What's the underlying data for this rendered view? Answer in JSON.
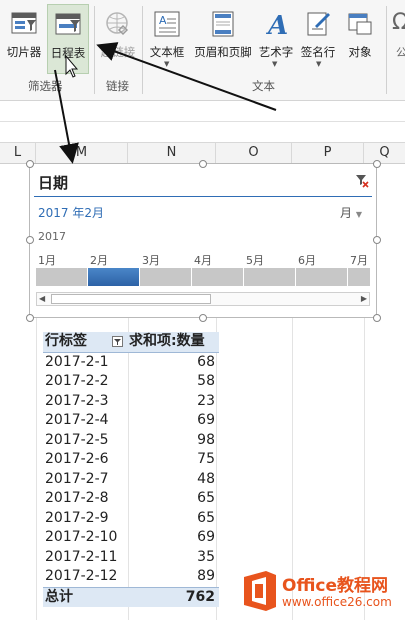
{
  "ribbon": {
    "buttons": {
      "slicer": "切片器",
      "timeline": "日程表",
      "link": "超链接",
      "textbox": "文本框",
      "header_footer": "页眉和页脚",
      "wordart": "艺术字",
      "signature": "签名行",
      "object": "对象"
    },
    "groups": {
      "filter": "筛选器",
      "links": "链接",
      "text": "文本"
    }
  },
  "columns": [
    "L",
    "M",
    "N",
    "O",
    "P",
    "Q"
  ],
  "timeline": {
    "title": "日期",
    "selection": "2017 年2月",
    "level": "月",
    "year": "2017",
    "months": [
      "1月",
      "2月",
      "3月",
      "4月",
      "5月",
      "6月",
      "7月"
    ],
    "selected_month": "2月"
  },
  "pivot": {
    "header_label": "行标签",
    "header_value": "求和项:数量",
    "rows": [
      {
        "k": "2017-2-1",
        "v": "68"
      },
      {
        "k": "2017-2-2",
        "v": "58"
      },
      {
        "k": "2017-2-3",
        "v": "23"
      },
      {
        "k": "2017-2-4",
        "v": "69"
      },
      {
        "k": "2017-2-5",
        "v": "98"
      },
      {
        "k": "2017-2-6",
        "v": "75"
      },
      {
        "k": "2017-2-7",
        "v": "48"
      },
      {
        "k": "2017-2-8",
        "v": "65"
      },
      {
        "k": "2017-2-9",
        "v": "65"
      },
      {
        "k": "2017-2-10",
        "v": "69"
      },
      {
        "k": "2017-2-11",
        "v": "35"
      },
      {
        "k": "2017-2-12",
        "v": "89"
      }
    ],
    "total_label": "总计",
    "total_value": "762"
  },
  "watermark": {
    "brand": "Office教程网",
    "url": "www.office26.com"
  },
  "colors": {
    "accent": "#2f6db5",
    "orange": "#e8541d",
    "ribbon_bg": "#f6f6f6"
  }
}
